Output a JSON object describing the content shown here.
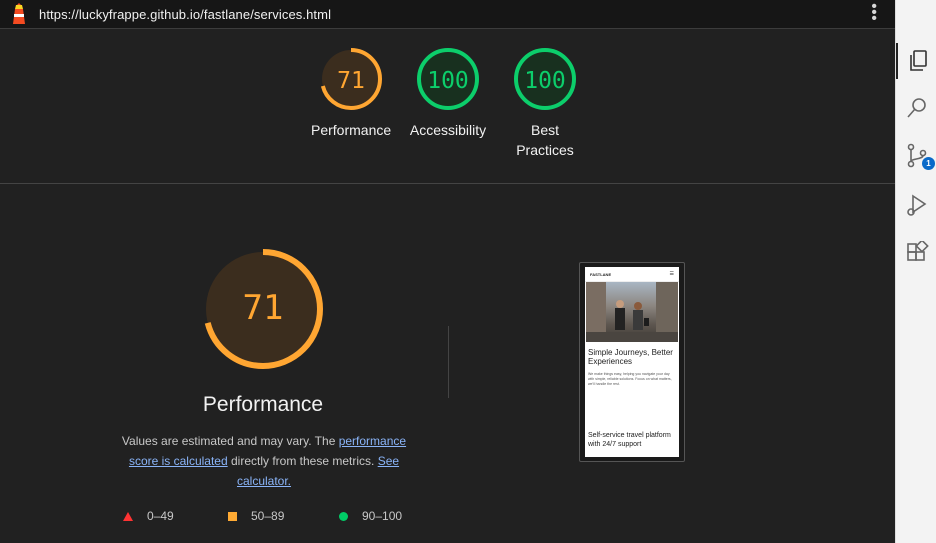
{
  "topbar": {
    "url": "https://luckyfrappe.github.io/fastlane/services.html",
    "logo_icon": "lighthouse-icon",
    "menu_icon": "more-vertical-icon"
  },
  "scores": [
    {
      "label": "Performance",
      "value": "71",
      "level": 0.71,
      "color": "#ffa632",
      "bg": "#3b2d1e"
    },
    {
      "label": "Accessibility",
      "value": "100",
      "level": 1.0,
      "color": "#0cce6b",
      "bg": "#18301f"
    },
    {
      "label": "Best Practices",
      "value": "100",
      "level": 1.0,
      "color": "#0cce6b",
      "bg": "#18301f"
    }
  ],
  "performance": {
    "score": "71",
    "level": 0.71,
    "title": "Performance",
    "desc_prefix": "Values are estimated and may vary. The ",
    "desc_link1": "performance score is calculated",
    "desc_middle": " directly from these metrics. ",
    "desc_link2": "See calculator."
  },
  "legend": [
    {
      "range": "0–49",
      "shape": "triangle",
      "color": "#ff3333"
    },
    {
      "range": "50–89",
      "shape": "square",
      "color": "#ffaa33"
    },
    {
      "range": "90–100",
      "shape": "circle",
      "color": "#00cc66"
    }
  ],
  "phone_preview": {
    "brand": "FASTLANE",
    "heading": "Simple Journeys, Better Experiences",
    "paragraph": "We make things easy, helping you navigate your day with simple, reliable solutions. Focus on what matters, we'll handle the rest.",
    "subheading": "Self-service travel platform with 24/7 support"
  },
  "sidebar": {
    "icons": [
      "explorer-icon",
      "search-icon",
      "source-control-icon",
      "run-debug-icon",
      "extensions-icon"
    ],
    "source_control_badge": "1"
  }
}
